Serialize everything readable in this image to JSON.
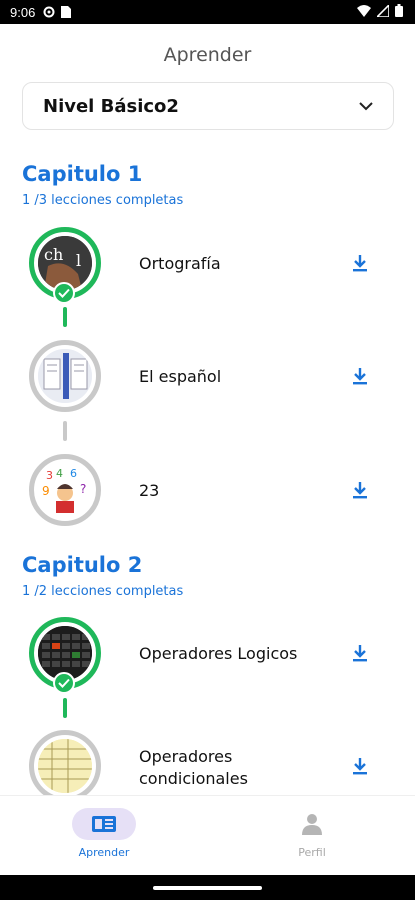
{
  "status_bar": {
    "time": "9:06"
  },
  "header": {
    "title": "Aprender"
  },
  "level_selector": {
    "value": "Nivel Básico2"
  },
  "chapters": [
    {
      "title": "Capitulo 1",
      "progress": "1 /3 lecciones completas",
      "lessons": [
        {
          "label": "Ortografía",
          "completed": true
        },
        {
          "label": "El español",
          "completed": false
        },
        {
          "label": "23",
          "completed": false
        }
      ]
    },
    {
      "title": "Capitulo 2",
      "progress": "1 /2 lecciones completas",
      "lessons": [
        {
          "label": "Operadores Logicos",
          "completed": true
        },
        {
          "label": "Operadores condicionales",
          "completed": false
        }
      ]
    }
  ],
  "bottom_nav": {
    "items": [
      {
        "label": "Aprender",
        "active": true
      },
      {
        "label": "Perfil",
        "active": false
      }
    ]
  },
  "colors": {
    "accent": "#1a73d8",
    "complete": "#1fb85a",
    "incomplete": "#c9c9c9",
    "nav_active_bg": "#e6e0f6"
  }
}
